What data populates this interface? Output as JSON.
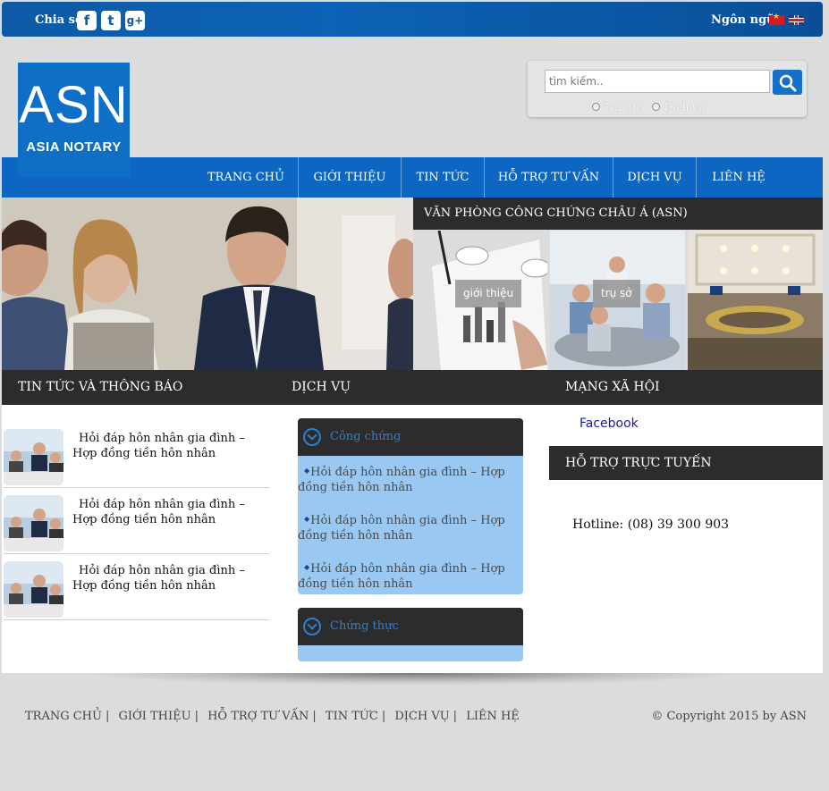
{
  "topbar": {
    "share_label": "Chia sẻ",
    "social": [
      {
        "icon": "facebook-icon",
        "glyph": "f"
      },
      {
        "icon": "twitter-icon",
        "glyph": "t"
      },
      {
        "icon": "google-plus-icon",
        "glyph": "g+"
      }
    ],
    "language_label": "Ngôn ngữ",
    "flags": [
      "vietnam-flag-icon",
      "uk-flag-icon"
    ]
  },
  "logo": {
    "main": "ASN",
    "sub": "ASIA NOTARY"
  },
  "search": {
    "placeholder": "tìm kiếm..",
    "options": [
      "Tin tức",
      "Dịch vụ"
    ]
  },
  "nav": {
    "items": [
      "TRANG CHỦ",
      "GIỚI THIỆU",
      "TIN TỨC",
      "HỖ TRỢ TƯ VẤN",
      "DỊCH VỤ",
      "LIÊN HỆ"
    ]
  },
  "office": {
    "title": "VĂN PHÒNG CÔNG CHỨNG CHÂU Á (ASN)",
    "thumbs": [
      "giới thiệu",
      "trụ sở",
      ""
    ]
  },
  "news": {
    "heading": "TIN TỨC VÀ THÔNG BÁO",
    "items": [
      "Hỏi đáp hôn nhân gia đình – Hợp đồng tiền hôn nhân",
      "Hỏi đáp hôn nhân gia đình – Hợp đồng tiền hôn nhân",
      "Hỏi đáp hôn nhân gia đình – Hợp đồng tiền hôn nhân"
    ]
  },
  "services": {
    "heading": "DỊCH VỤ",
    "boxes": [
      {
        "title": "Công chứng",
        "links": [
          "Hỏi đáp hôn nhân gia đình – Hợp đồng tiền hôn nhân",
          "Hỏi đáp hôn nhân gia đình – Hợp đồng tiền hôn nhân",
          "Hỏi đáp hôn nhân gia đình – Hợp đồng tiền hôn nhân"
        ]
      },
      {
        "title": "Chứng thực",
        "links": []
      }
    ]
  },
  "social": {
    "heading": "MẠNG XÃ HỘI",
    "facebook": "Facebook"
  },
  "support": {
    "heading": "HỖ TRỢ TRỰC TUYẾN",
    "hotline": "Hotline: (08) 39 300 903"
  },
  "footer": {
    "links": [
      "TRANG CHỦ",
      "GIỚI THIỆU",
      "HỖ TRỢ TƯ VẤN",
      "TIN TỨC",
      "DỊCH VỤ",
      "LIÊN HỆ"
    ],
    "copyright": "© Copyright 2015 by ASN"
  },
  "colors": {
    "brand_blue": "#0d67c2",
    "dark_header": "#2c2c2c",
    "service_bg": "#99c9f2"
  }
}
